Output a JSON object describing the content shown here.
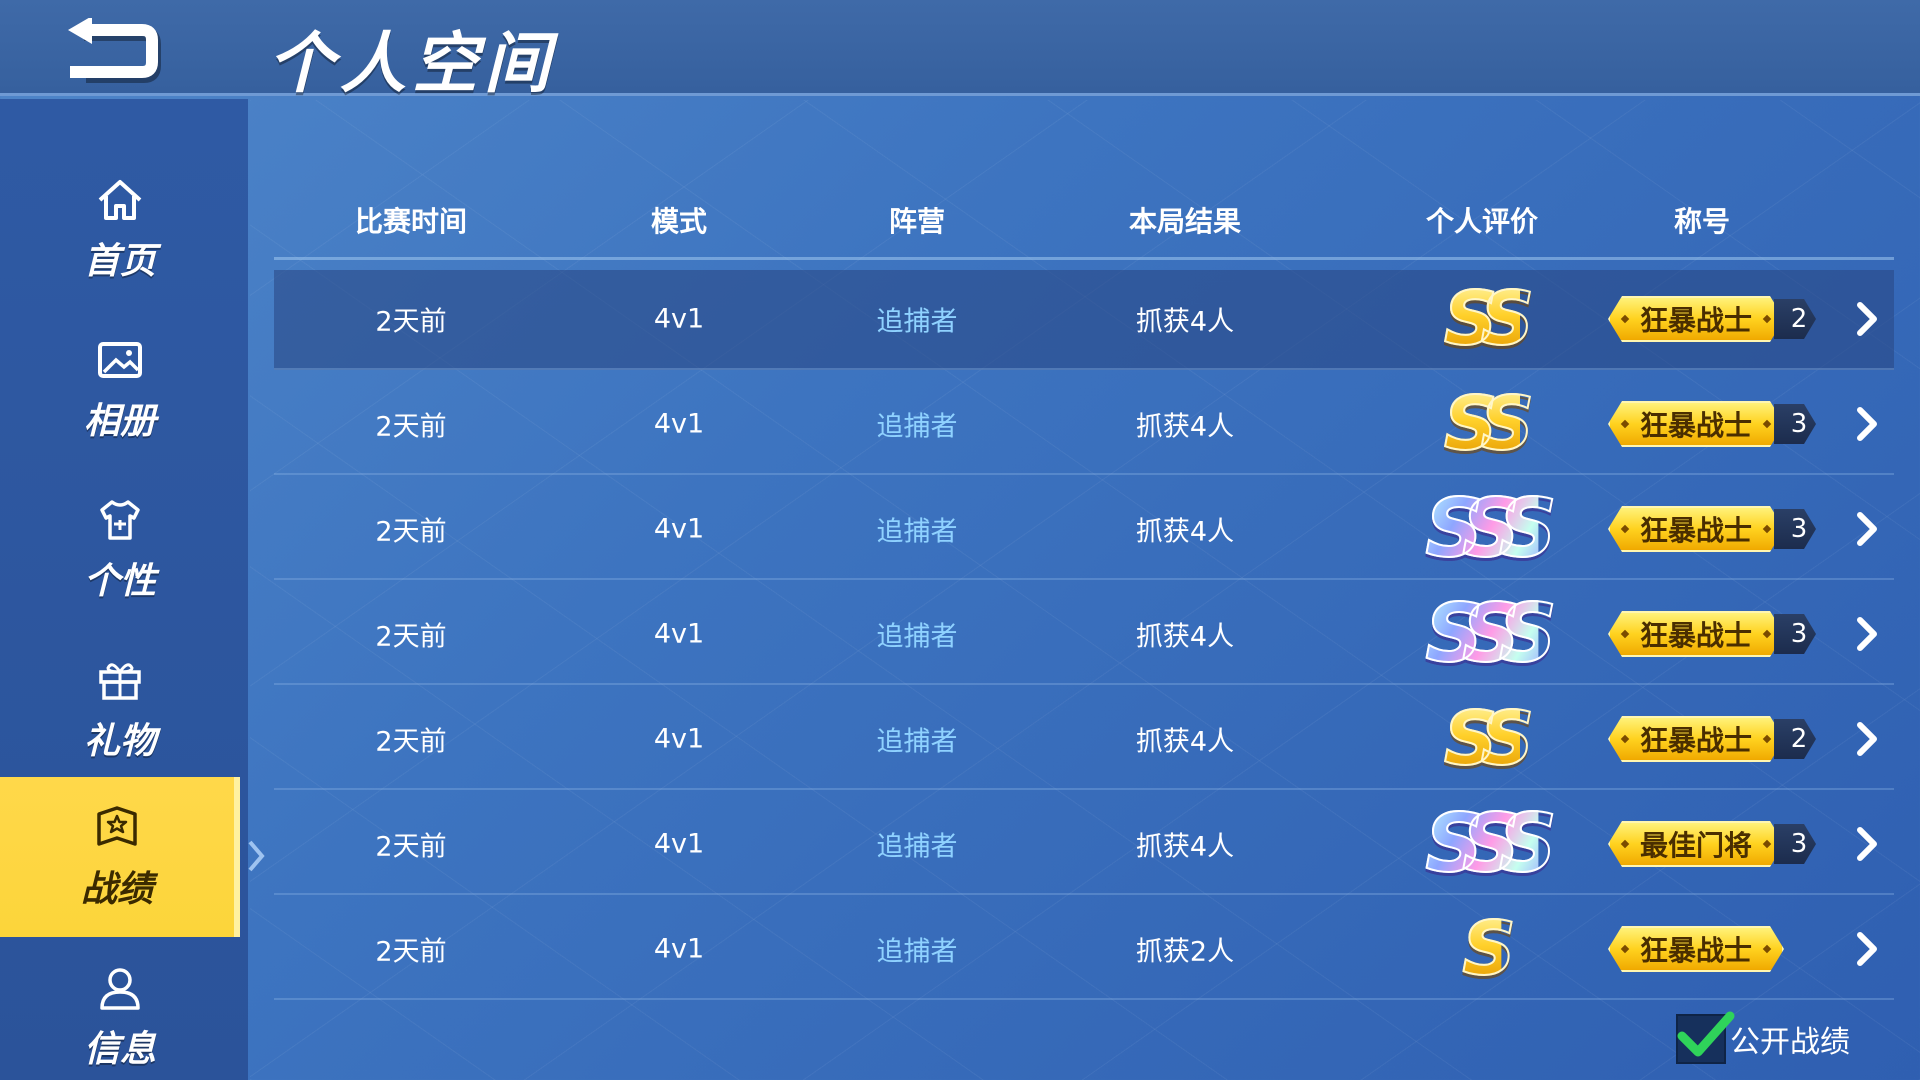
{
  "header": {
    "title": "个人空间"
  },
  "sidebar": {
    "items": [
      {
        "label": "首页",
        "icon": "home-icon"
      },
      {
        "label": "相册",
        "icon": "image-icon"
      },
      {
        "label": "个性",
        "icon": "shirt-icon"
      },
      {
        "label": "礼物",
        "icon": "gift-icon"
      },
      {
        "label": "战绩",
        "icon": "badge-icon",
        "active": true
      },
      {
        "label": "信息",
        "icon": "user-icon"
      }
    ]
  },
  "table": {
    "headers": [
      "比赛时间",
      "模式",
      "阵营",
      "本局结果",
      "个人评价",
      "称号"
    ],
    "rows": [
      {
        "time": "2天前",
        "mode": "4v1",
        "faction": "追捕者",
        "result": "抓获4人",
        "grade": "SS",
        "title": "狂暴战士",
        "count": "2"
      },
      {
        "time": "2天前",
        "mode": "4v1",
        "faction": "追捕者",
        "result": "抓获4人",
        "grade": "SS",
        "title": "狂暴战士",
        "count": "3"
      },
      {
        "time": "2天前",
        "mode": "4v1",
        "faction": "追捕者",
        "result": "抓获4人",
        "grade": "SSS",
        "title": "狂暴战士",
        "count": "3"
      },
      {
        "time": "2天前",
        "mode": "4v1",
        "faction": "追捕者",
        "result": "抓获4人",
        "grade": "SSS",
        "title": "狂暴战士",
        "count": "3"
      },
      {
        "time": "2天前",
        "mode": "4v1",
        "faction": "追捕者",
        "result": "抓获4人",
        "grade": "SS",
        "title": "狂暴战士",
        "count": "2"
      },
      {
        "time": "2天前",
        "mode": "4v1",
        "faction": "追捕者",
        "result": "抓获4人",
        "grade": "SSS",
        "title": "最佳门将",
        "count": "3"
      },
      {
        "time": "2天前",
        "mode": "4v1",
        "faction": "追捕者",
        "result": "抓获2人",
        "grade": "S",
        "title": "狂暴战士",
        "count": ""
      }
    ]
  },
  "footer": {
    "public_label": "公开战绩",
    "public_checked": true
  },
  "colors": {
    "accent": "#fcd53a",
    "faction": "#8fd2ff",
    "check": "#2fd35a"
  }
}
